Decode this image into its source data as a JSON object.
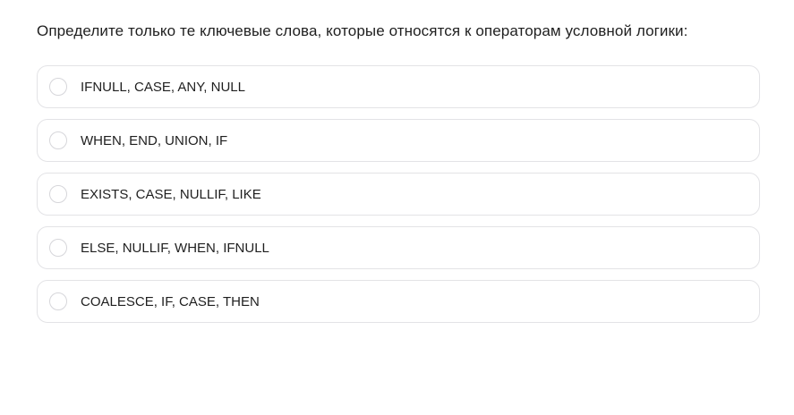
{
  "question": {
    "text": "Определите только те ключевые слова, которые относятся к операторам условной логики:"
  },
  "options": [
    {
      "label": "IFNULL, CASE, ANY, NULL",
      "selected": false
    },
    {
      "label": "WHEN, END, UNION, IF",
      "selected": false
    },
    {
      "label": "EXISTS, CASE, NULLIF, LIKE",
      "selected": false
    },
    {
      "label": "ELSE, NULLIF, WHEN, IFNULL",
      "selected": false
    },
    {
      "label": "COALESCE, IF, CASE, THEN",
      "selected": false
    }
  ]
}
